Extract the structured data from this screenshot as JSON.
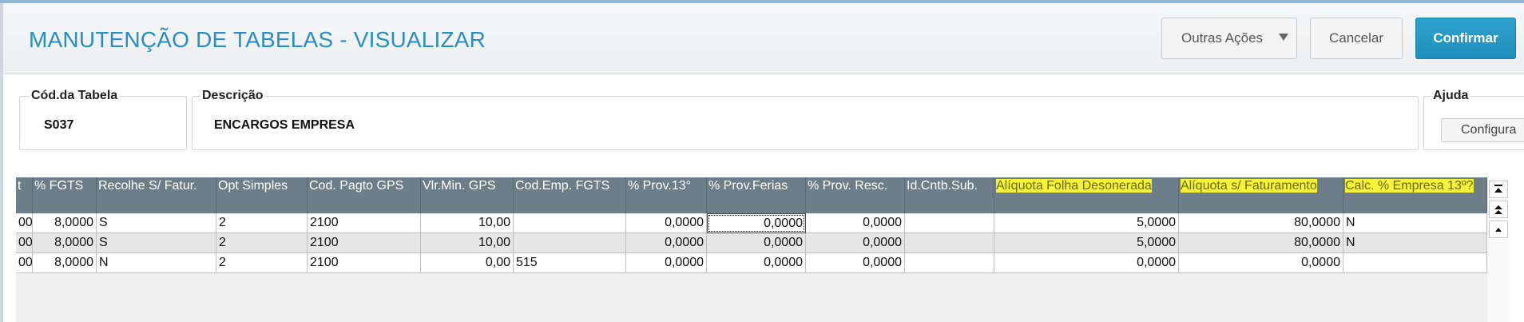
{
  "header": {
    "title": "MANUTENÇÃO DE TABELAS - VISUALIZAR",
    "buttons": {
      "more_actions": "Outras Ações",
      "cancel": "Cancelar",
      "confirm": "Confirmar"
    }
  },
  "fields": {
    "code": {
      "label": "Cód.da Tabela",
      "value": "S037"
    },
    "description": {
      "label": "Descrição",
      "value": "ENCARGOS EMPRESA"
    },
    "help": {
      "label": "Ajuda",
      "button": "Configura"
    }
  },
  "grid": {
    "columns": [
      "t",
      "% FGTS",
      "Recolhe S/ Fatur.",
      "Opt Simples",
      "Cod. Pagto GPS",
      "Vlr.Min. GPS",
      "Cod.Emp. FGTS",
      "% Prov.13°",
      "% Prov.Ferias",
      "% Prov. Resc.",
      "Id.Cntb.Sub.",
      "Alíquota Folha Desonerada",
      "Alíquota s/ Faturamento",
      "Calc. % Empresa 13º?"
    ],
    "rows": [
      [
        "00",
        "8,0000",
        "S",
        "2",
        "2100",
        "10,00",
        "",
        "0,0000",
        "0,0000",
        "0,0000",
        "",
        "5,0000",
        "80,0000",
        "N"
      ],
      [
        "00",
        "8,0000",
        "S",
        "2",
        "2100",
        "10,00",
        "",
        "0,0000",
        "0,0000",
        "0,0000",
        "",
        "5,0000",
        "80,0000",
        "N"
      ],
      [
        "00",
        "8,0000",
        "N",
        "2",
        "2100",
        "0,00",
        "515",
        "0,0000",
        "0,0000",
        "0,0000",
        "",
        "0,0000",
        "0,0000",
        ""
      ]
    ],
    "nav_icons": [
      "scroll-top-icon",
      "page-up-icon",
      "row-up-icon"
    ]
  },
  "colors": {
    "accent": "#2a8fc0",
    "confirm": "#1f8dba",
    "grid_header": "#6e7e88",
    "highlight": "#f6f23a"
  }
}
